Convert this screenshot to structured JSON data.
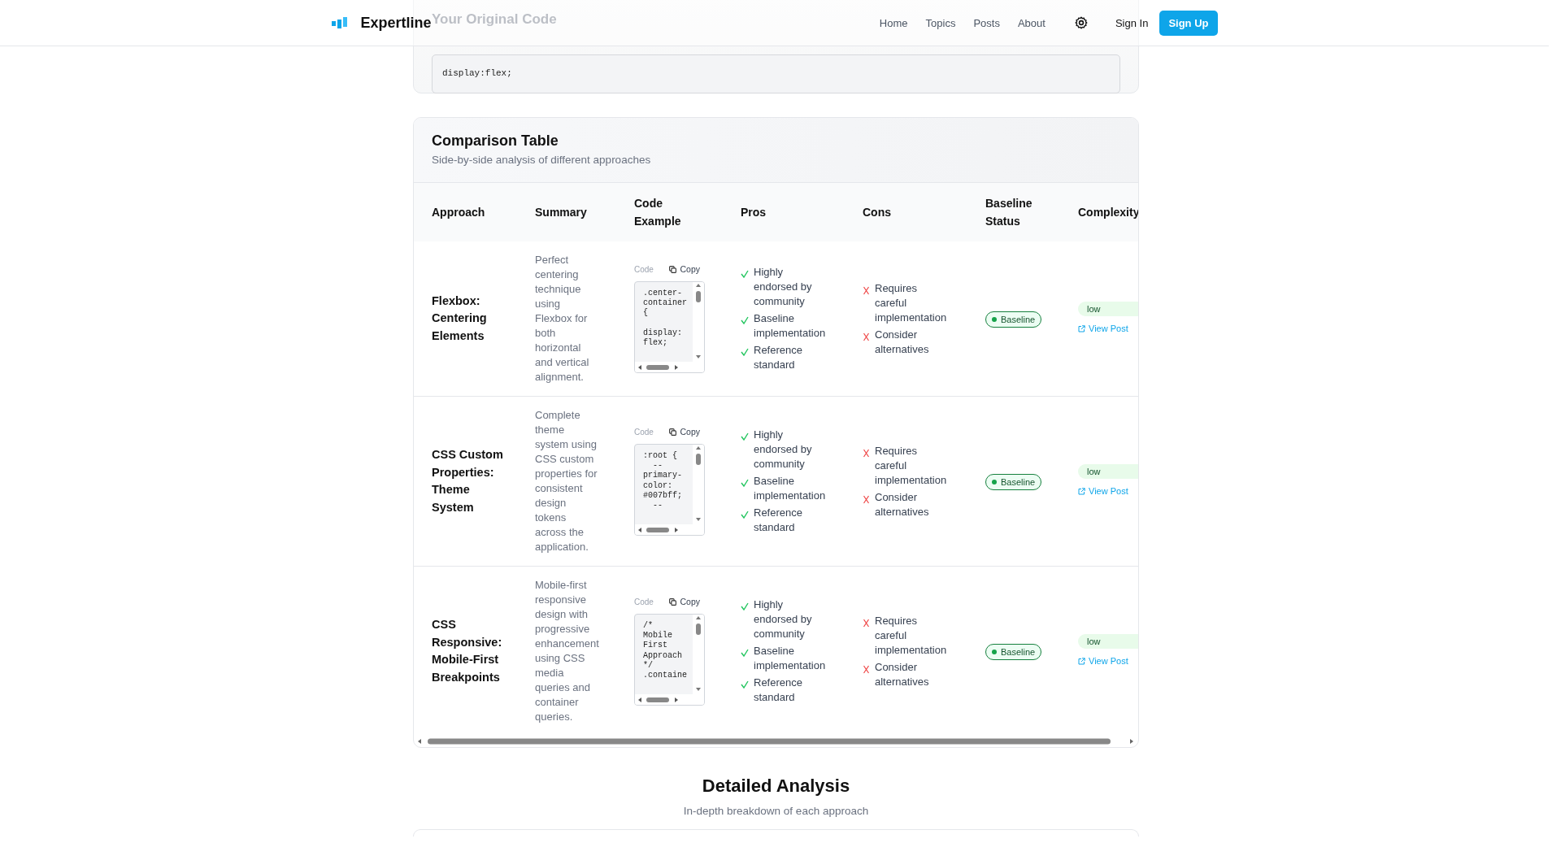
{
  "header": {
    "logo": "Expertline",
    "nav": [
      {
        "label": "Home"
      },
      {
        "label": "Topics"
      },
      {
        "label": "Posts"
      },
      {
        "label": "About"
      }
    ],
    "sign_in": "Sign In",
    "sign_up": "Sign Up"
  },
  "original_code_card": {
    "title": "Your Original Code",
    "code": "display:flex;"
  },
  "comparison": {
    "title": "Comparison Table",
    "subtitle": "Side-by-side analysis of different approaches",
    "columns": [
      "Approach",
      "Summary",
      "Code Example",
      "Pros",
      "Cons",
      "Baseline Status",
      "Complexity"
    ],
    "rows": [
      {
        "approach": "Flexbox: Centering Elements",
        "summary": "Perfect centering technique using Flexbox for both horizontal and vertical alignment.",
        "code_label": "Code",
        "copy_label": "Copy",
        "code_lines": [
          ".center-",
          "container",
          "{",
          "display:",
          "flex;"
        ],
        "pros": [
          "Highly endorsed by community",
          "Baseline implementation",
          "Reference standard"
        ],
        "cons": [
          "Requires careful implementation",
          "Consider alternatives"
        ],
        "baseline": "Baseline",
        "complexity": "low",
        "link": "View Post"
      },
      {
        "approach": "CSS Custom Properties: Theme System",
        "summary": "Complete theme system using CSS custom properties for consistent design tokens across the application.",
        "code_label": "Code",
        "copy_label": "Copy",
        "code_lines": [
          ":root {",
          "  --",
          "primary-",
          "color:",
          "#007bff;",
          "  --"
        ],
        "pros": [
          "Highly endorsed by community",
          "Baseline implementation",
          "Reference standard"
        ],
        "cons": [
          "Requires careful implementation",
          "Consider alternatives"
        ],
        "baseline": "Baseline",
        "complexity": "low",
        "link": "View Post"
      },
      {
        "approach": "CSS Responsive: Mobile-First Breakpoints",
        "summary": "Mobile-first responsive design with progressive enhancement using CSS media queries and container queries.",
        "code_label": "Code",
        "copy_label": "Copy",
        "code_lines": [
          "/*",
          "Mobile",
          "First",
          "Approach",
          "*/",
          ".containe"
        ],
        "pros": [
          "Highly endorsed by community",
          "Baseline implementation",
          "Reference standard"
        ],
        "cons": [
          "Requires careful implementation",
          "Consider alternatives"
        ],
        "baseline": "Baseline",
        "complexity": "low",
        "link": "View Post"
      }
    ]
  },
  "detailed_analysis": {
    "title": "Detailed Analysis",
    "subtitle": "In-depth breakdown of each approach"
  }
}
